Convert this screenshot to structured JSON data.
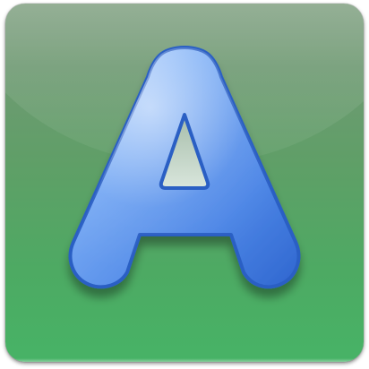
{
  "icon": {
    "letter": "A",
    "semantic": "letter-a-app-icon",
    "colors": {
      "background_top": "#86a487",
      "background_bottom": "#47b366",
      "letter_light": "#a9ccff",
      "letter_mid": "#5f96ee",
      "letter_dark": "#2c63c9",
      "letter_outline": "#2a5fc4"
    }
  }
}
